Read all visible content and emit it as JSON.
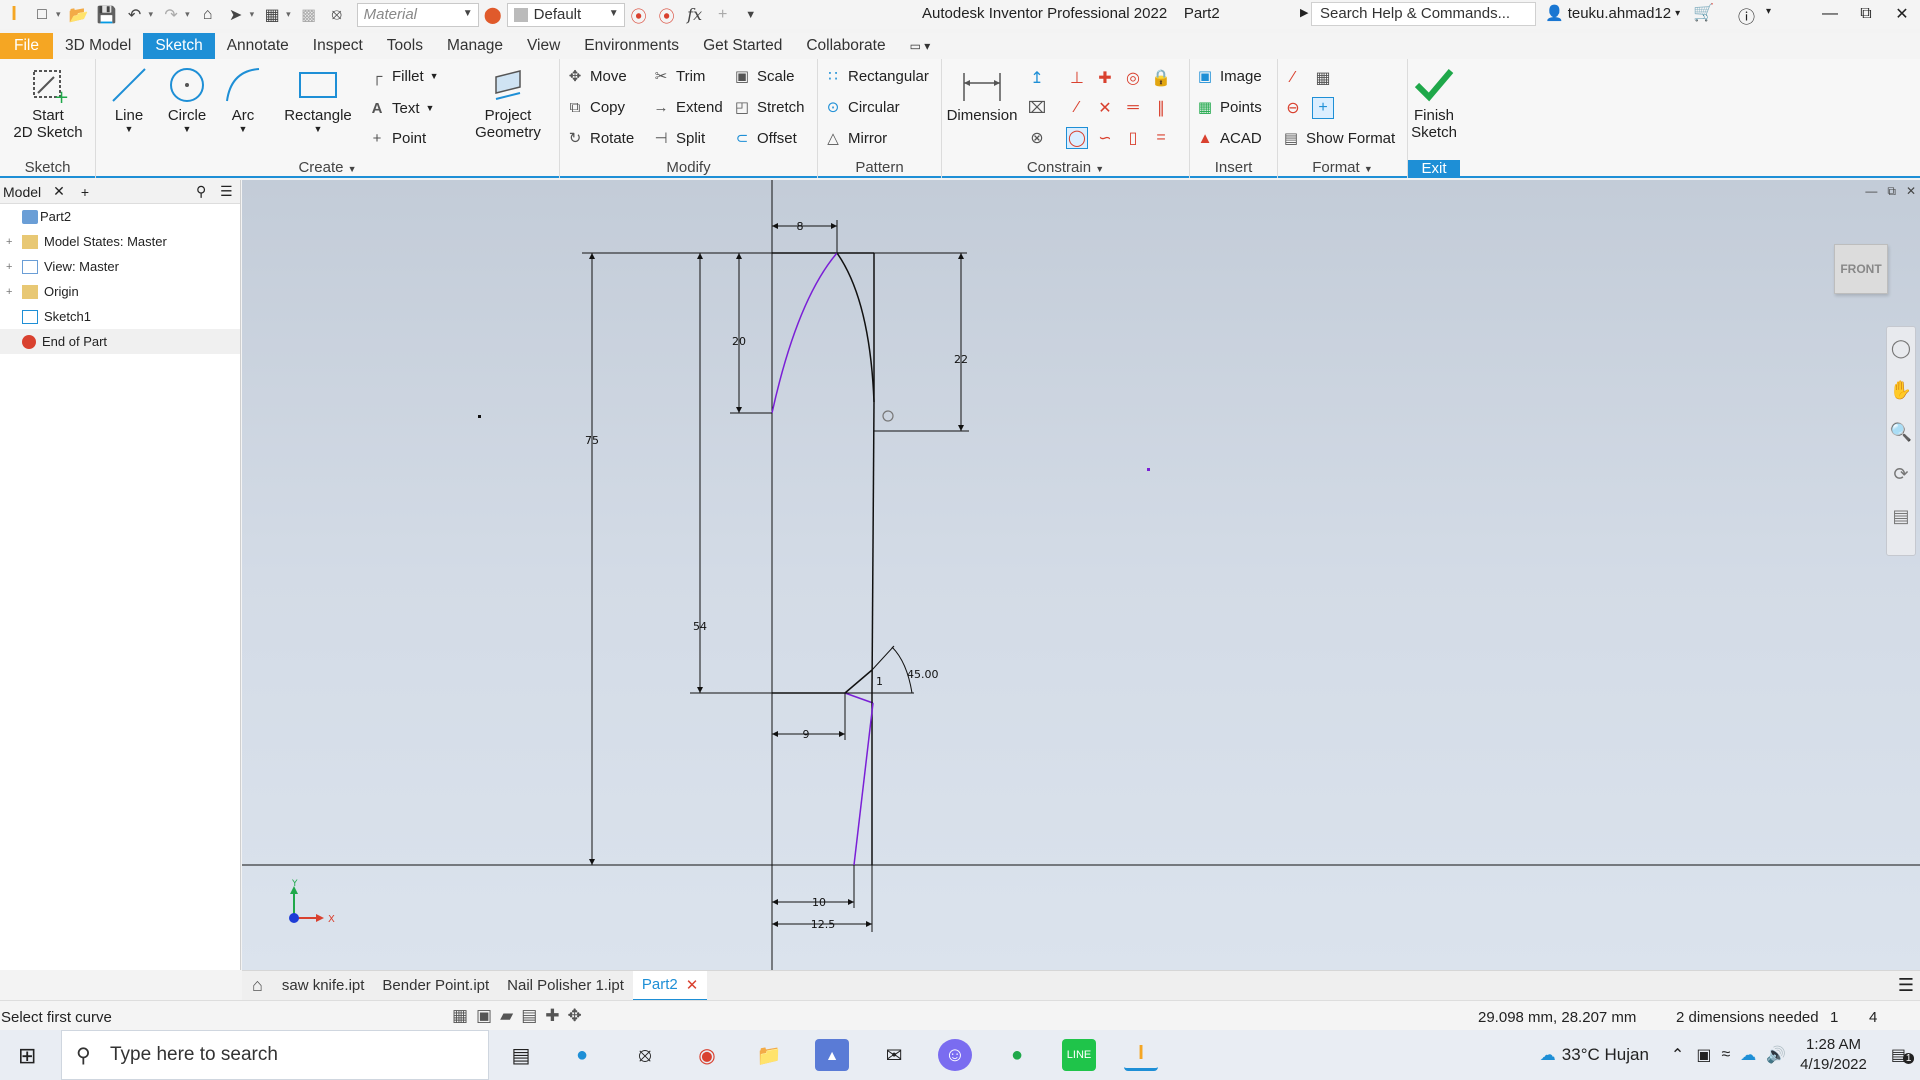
{
  "titlebar": {
    "material_placeholder": "Material",
    "appearance_value": "Default",
    "app_title": "Autodesk Inventor Professional 2022",
    "doc_title": "Part2",
    "search_placeholder": "Search Help & Commands...",
    "user": "teuku.ahmad12"
  },
  "ribbon_tabs": [
    "File",
    "3D Model",
    "Sketch",
    "Annotate",
    "Inspect",
    "Tools",
    "Manage",
    "View",
    "Environments",
    "Get Started",
    "Collaborate"
  ],
  "ribbon": {
    "sketch_panel": {
      "start_label_1": "Start",
      "start_label_2": "2D Sketch",
      "label": "Sketch"
    },
    "create_panel": {
      "line": "Line",
      "circle": "Circle",
      "arc": "Arc",
      "rectangle": "Rectangle",
      "fillet": "Fillet",
      "text": "Text",
      "point": "Point",
      "project_1": "Project",
      "project_2": "Geometry",
      "label": "Create"
    },
    "modify_panel": {
      "move": "Move",
      "trim": "Trim",
      "scale": "Scale",
      "copy": "Copy",
      "extend": "Extend",
      "stretch": "Stretch",
      "rotate": "Rotate",
      "split": "Split",
      "offset": "Offset",
      "label": "Modify"
    },
    "pattern_panel": {
      "rectangular": "Rectangular",
      "circular": "Circular",
      "mirror": "Mirror",
      "label": "Pattern"
    },
    "constrain_panel": {
      "dimension": "Dimension",
      "label": "Constrain"
    },
    "insert_panel": {
      "image": "Image",
      "points": "Points",
      "acad": "ACAD",
      "label": "Insert"
    },
    "format_panel": {
      "show_format": "Show Format",
      "label": "Format"
    },
    "exit_panel": {
      "finish_1": "Finish",
      "finish_2": "Sketch",
      "label": "Exit"
    }
  },
  "browser": {
    "tab": "Model",
    "items": [
      {
        "label": "Part2"
      },
      {
        "label": "Model States: Master"
      },
      {
        "label": "View: Master"
      },
      {
        "label": "Origin"
      },
      {
        "label": "Sketch1"
      },
      {
        "label": "End of Part"
      }
    ]
  },
  "viewcube": {
    "label": "FRONT"
  },
  "dimensions": {
    "top_width": "8",
    "left_height_small": "20",
    "right_height": "22",
    "overall_height": "75",
    "lower_height": "54",
    "angle": "45.00",
    "small": "1",
    "bottom_inner": "9",
    "bottom_10": "10",
    "bottom_12_5": "12.5"
  },
  "axis": {
    "x": "X",
    "y": "Y"
  },
  "doc_tabs": [
    "saw knife.ipt",
    "Bender Point.ipt",
    "Nail Polisher 1.ipt",
    "Part2"
  ],
  "status": {
    "prompt": "Select first curve",
    "coords": "29.098 mm, 28.207 mm",
    "dims_needed": "2 dimensions needed",
    "count1": "1",
    "count2": "4"
  },
  "taskbar": {
    "search_placeholder": "Type here to search",
    "weather": "33°C  Hujan",
    "time": "1:28 AM",
    "date": "4/19/2022",
    "notif": "1"
  },
  "colors": {
    "accent": "#1e8fd6",
    "file_tab": "#f5a623",
    "sketch_purple": "#7a1fd6",
    "finish_green": "#1fa84a"
  }
}
